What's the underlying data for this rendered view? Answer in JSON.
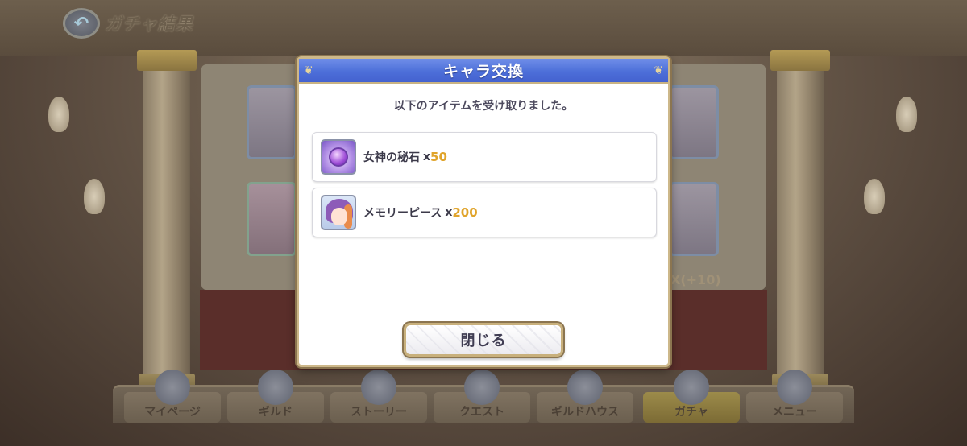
{
  "header": {
    "back_icon": "back-arrow-icon",
    "title": "ガチャ結果"
  },
  "background": {
    "nav_tabs": [
      {
        "label": "マイページ",
        "icon": "mypage-icon"
      },
      {
        "label": "ギルド",
        "icon": "guild-icon"
      },
      {
        "label": "ストーリー",
        "icon": "story-icon"
      },
      {
        "label": "クエスト",
        "icon": "quest-icon"
      },
      {
        "label": "ギルドハウス",
        "icon": "guildhouse-icon"
      },
      {
        "label": "ガチャ",
        "icon": "gacha-icon"
      },
      {
        "label": "メニュー",
        "icon": "menu-icon"
      }
    ],
    "side_note": "X(+10)"
  },
  "modal": {
    "title": "キャラ交換",
    "message": "以下のアイテムを受け取りました。",
    "rewards": [
      {
        "name": "女神の秘石",
        "x": "x",
        "quantity": "50",
        "icon": "goddess-stone-icon"
      },
      {
        "name": "メモリーピース",
        "x": "x",
        "quantity": "200",
        "icon": "memory-piece-icon"
      }
    ],
    "close_label": "閉じる"
  },
  "colors": {
    "modal_header": "#4d6fd9",
    "modal_border": "#cdb88a",
    "quantity_accent": "#e0a42b"
  }
}
